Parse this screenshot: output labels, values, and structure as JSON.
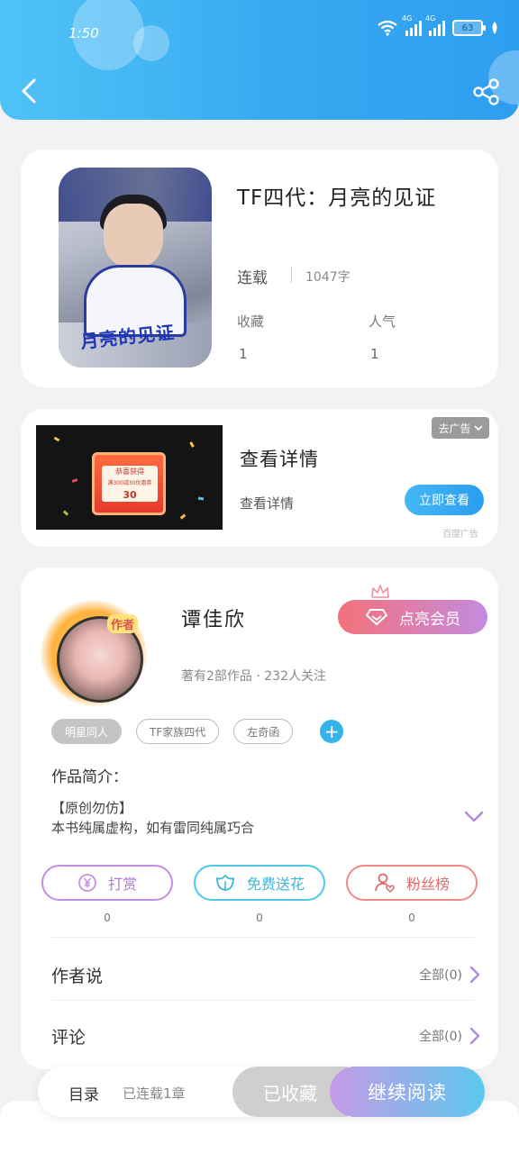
{
  "status_bar": {
    "time": "1:50",
    "network_1": "4G",
    "network_2": "4G",
    "battery": "63"
  },
  "book": {
    "title": "TF四代：月亮的见证",
    "cover_text": "月亮的见证",
    "status": "连载",
    "word_count": "1047字",
    "favorites_label": "收藏",
    "favorites_value": "1",
    "popularity_label": "人气",
    "popularity_value": "1"
  },
  "ad": {
    "close_label": "去广告",
    "title": "查看详情",
    "subtitle": "查看详情",
    "button_label": "立即查看",
    "source": "百度广告",
    "image_heading": "恭喜获得",
    "image_sub": "满300减30优惠券",
    "image_amount": "30"
  },
  "author": {
    "badge": "作者",
    "name": "谭佳欣",
    "vip_label": "点亮会员",
    "meta": "著有2部作品 · 232人关注",
    "tags": [
      "明星同人",
      "TF家族四代",
      "左奇函"
    ],
    "intro_label": "作品简介：",
    "intro_line1": "【原创勿仿】",
    "intro_line2": "本书纯属虚构，如有雷同纯属巧合"
  },
  "actions": [
    {
      "label": "打赏",
      "count": "0",
      "icon": "yen-coin-icon"
    },
    {
      "label": "免费送花",
      "count": "0",
      "icon": "flower-icon"
    },
    {
      "label": "粉丝榜",
      "count": "0",
      "icon": "fan-user-icon"
    }
  ],
  "links": [
    {
      "title": "作者说",
      "value": "全部(0)"
    },
    {
      "title": "评论",
      "value": "全部(0)"
    }
  ],
  "bottom_bar": {
    "toc_label": "目录",
    "toc_count": "已连载1章",
    "collect_label": "已收藏",
    "read_label": "继续阅读"
  },
  "colors": {
    "header": "#38a8f0",
    "accent_blue": "#34b4ea",
    "vip_start": "#f4717b",
    "vip_end": "#c48be0"
  }
}
